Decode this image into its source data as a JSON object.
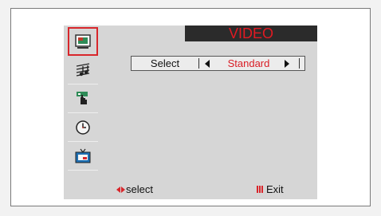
{
  "menu": {
    "title": "VIDEO",
    "icons": [
      {
        "name": "picture-icon",
        "active": true
      },
      {
        "name": "sound-icon",
        "active": false
      },
      {
        "name": "channel-icon",
        "active": false
      },
      {
        "name": "timer-icon",
        "active": false
      },
      {
        "name": "setup-icon",
        "active": false
      }
    ]
  },
  "setting": {
    "label": "Select",
    "value": "Standard"
  },
  "footer": {
    "select_label": "select",
    "exit_label": "Exit"
  },
  "colors": {
    "accent": "#d8262b",
    "title_bg": "#2b2b2b",
    "panel_bg": "#d6d6d6"
  }
}
